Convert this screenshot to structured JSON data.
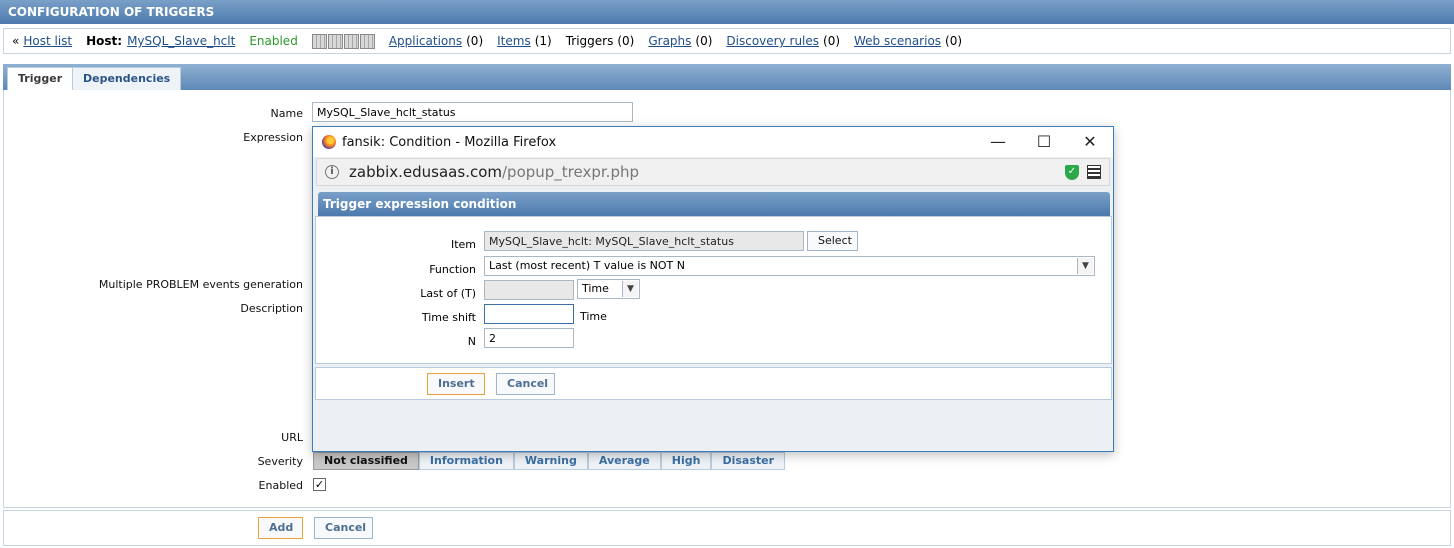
{
  "page": {
    "title": "CONFIGURATION OF TRIGGERS"
  },
  "host_nav": {
    "host_list_prefix": "«",
    "host_list": "Host list",
    "host_label": "Host:",
    "host_name": "MySQL_Slave_hclt",
    "status": "Enabled",
    "applications": "Applications",
    "applications_count": "(0)",
    "items": "Items",
    "items_count": "(1)",
    "triggers": "Triggers",
    "triggers_count": "(0)",
    "graphs": "Graphs",
    "graphs_count": "(0)",
    "discovery": "Discovery rules",
    "discovery_count": "(0)",
    "web": "Web scenarios",
    "web_count": "(0)"
  },
  "tabs": [
    {
      "label": "Trigger"
    },
    {
      "label": "Dependencies"
    }
  ],
  "form": {
    "name_label": "Name",
    "name_value": "MySQL_Slave_hclt_status",
    "expression_label": "Expression",
    "multiple_label": "Multiple PROBLEM events generation",
    "description_label": "Description",
    "url_label": "URL",
    "severity_label": "Severity",
    "severity_options": [
      "Not classified",
      "Information",
      "Warning",
      "Average",
      "High",
      "Disaster"
    ],
    "enabled_label": "Enabled",
    "enabled_check": "✓"
  },
  "footer": {
    "add": "Add",
    "cancel": "Cancel"
  },
  "popup": {
    "window_title": "fansik: Condition - Mozilla Firefox",
    "url_host": "zabbix.edusaas.com",
    "url_path": "/popup_trexpr.php",
    "header": "Trigger expression condition",
    "item_label": "Item",
    "item_value": "MySQL_Slave_hclt: MySQL_Slave_hclt_status",
    "select": "Select",
    "function_label": "Function",
    "function_value": "Last (most recent) T value is NOT N",
    "last_of_label": "Last of (T)",
    "last_of_unit": "Time",
    "time_shift_label": "Time shift",
    "time_shift_unit": "Time",
    "n_label": "N",
    "n_value": "2",
    "insert": "Insert",
    "cancel": "Cancel"
  },
  "colors": {
    "header": "#4b79ad",
    "enabled": "#2a9a2a",
    "link": "#1f4e8a"
  }
}
